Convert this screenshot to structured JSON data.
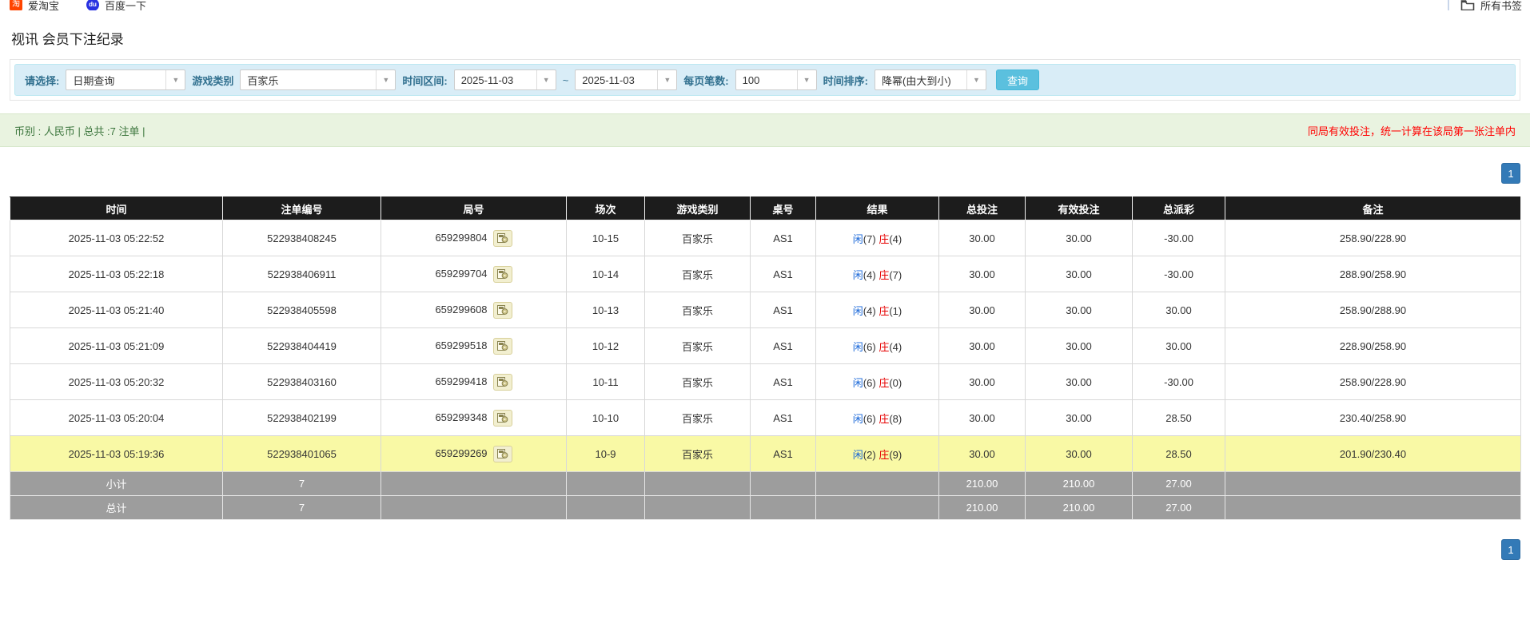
{
  "colors": {
    "header_bg": "#1c1c1c",
    "subtotal_bg": "#9d9d9d",
    "highlight_bg": "#f9f9a5",
    "player_blue": "#1766d8",
    "banker_red": "#e60000",
    "negative_red": "#ff0000",
    "note_red": "#ff0000",
    "info_bg": "#d9edf7",
    "info_border": "#bce8f1",
    "info_text": "#31708f",
    "success_bg": "#e9f3e0",
    "success_text": "#3c763d",
    "button_bg": "#5bc0de",
    "button_border": "#46b8da",
    "page_btn_bg": "#337ab7",
    "taobao_red": "#ff4400",
    "baidu_blue": "#2932e1"
  },
  "bookmarks_bar": {
    "taobao_label": "爱淘宝",
    "taobao_icon_glyph": "淘",
    "baidu_label": "百度一下",
    "baidu_icon_glyph": "du",
    "all_bookmarks_label": "所有书签"
  },
  "page_title": "视讯 会员下注纪录",
  "filter": {
    "select_label": "请选择:",
    "select_value": "日期查询",
    "game_label": "游戏类别",
    "game_value": "百家乐",
    "range_label": "时间区间:",
    "date_from": "2025-11-03",
    "tilde": "~",
    "date_to": "2025-11-03",
    "per_page_label": "每页笔数:",
    "per_page_value": "100",
    "sort_label": "时间排序:",
    "sort_value": "降幂(由大到小)",
    "search_button": "查询"
  },
  "summary": {
    "left": "币别 : 人民币 | 总共 :7 注单 |",
    "right": "同局有效投注，统一计算在该局第一张注单内"
  },
  "pagination": {
    "page": "1"
  },
  "table": {
    "columns": [
      "时间",
      "注单编号",
      "局号",
      "场次",
      "游戏类别",
      "桌号",
      "结果",
      "总投注",
      "有效投注",
      "总派彩",
      "备注"
    ],
    "rows": [
      {
        "time": "2025-11-03 05:22:52",
        "bet_no": "522938408245",
        "round_no": "659299804",
        "session": "10-15",
        "game": "百家乐",
        "table_no": "AS1",
        "result": {
          "player": "闲",
          "player_n": "(7)",
          "banker": "庄",
          "banker_n": "(4)"
        },
        "total_bet": "30.00",
        "valid_bet": "30.00",
        "payout": "-30.00",
        "note": "258.90/228.90",
        "highlight": false
      },
      {
        "time": "2025-11-03 05:22:18",
        "bet_no": "522938406911",
        "round_no": "659299704",
        "session": "10-14",
        "game": "百家乐",
        "table_no": "AS1",
        "result": {
          "player": "闲",
          "player_n": "(4)",
          "banker": "庄",
          "banker_n": "(7)"
        },
        "total_bet": "30.00",
        "valid_bet": "30.00",
        "payout": "-30.00",
        "note": "288.90/258.90",
        "highlight": false
      },
      {
        "time": "2025-11-03 05:21:40",
        "bet_no": "522938405598",
        "round_no": "659299608",
        "session": "10-13",
        "game": "百家乐",
        "table_no": "AS1",
        "result": {
          "player": "闲",
          "player_n": "(4)",
          "banker": "庄",
          "banker_n": "(1)"
        },
        "total_bet": "30.00",
        "valid_bet": "30.00",
        "payout": "30.00",
        "note": "258.90/288.90",
        "highlight": false
      },
      {
        "time": "2025-11-03 05:21:09",
        "bet_no": "522938404419",
        "round_no": "659299518",
        "session": "10-12",
        "game": "百家乐",
        "table_no": "AS1",
        "result": {
          "player": "闲",
          "player_n": "(6)",
          "banker": "庄",
          "banker_n": "(4)"
        },
        "total_bet": "30.00",
        "valid_bet": "30.00",
        "payout": "30.00",
        "note": "228.90/258.90",
        "highlight": false
      },
      {
        "time": "2025-11-03 05:20:32",
        "bet_no": "522938403160",
        "round_no": "659299418",
        "session": "10-11",
        "game": "百家乐",
        "table_no": "AS1",
        "result": {
          "player": "闲",
          "player_n": "(6)",
          "banker": "庄",
          "banker_n": "(0)"
        },
        "total_bet": "30.00",
        "valid_bet": "30.00",
        "payout": "-30.00",
        "note": "258.90/228.90",
        "highlight": false
      },
      {
        "time": "2025-11-03 05:20:04",
        "bet_no": "522938402199",
        "round_no": "659299348",
        "session": "10-10",
        "game": "百家乐",
        "table_no": "AS1",
        "result": {
          "player": "闲",
          "player_n": "(6)",
          "banker": "庄",
          "banker_n": "(8)"
        },
        "total_bet": "30.00",
        "valid_bet": "30.00",
        "payout": "28.50",
        "note": "230.40/258.90",
        "highlight": false
      },
      {
        "time": "2025-11-03 05:19:36",
        "bet_no": "522938401065",
        "round_no": "659299269",
        "session": "10-9",
        "game": "百家乐",
        "table_no": "AS1",
        "result": {
          "player": "闲",
          "player_n": "(2)",
          "banker": "庄",
          "banker_n": "(9)"
        },
        "total_bet": "30.00",
        "valid_bet": "30.00",
        "payout": "28.50",
        "note": "201.90/230.40",
        "highlight": true
      }
    ],
    "subtotal": {
      "label": "小计",
      "count": "7",
      "total_bet": "210.00",
      "valid_bet": "210.00",
      "payout": "27.00"
    },
    "total": {
      "label": "总计",
      "count": "7",
      "total_bet": "210.00",
      "valid_bet": "210.00",
      "payout": "27.00"
    }
  }
}
